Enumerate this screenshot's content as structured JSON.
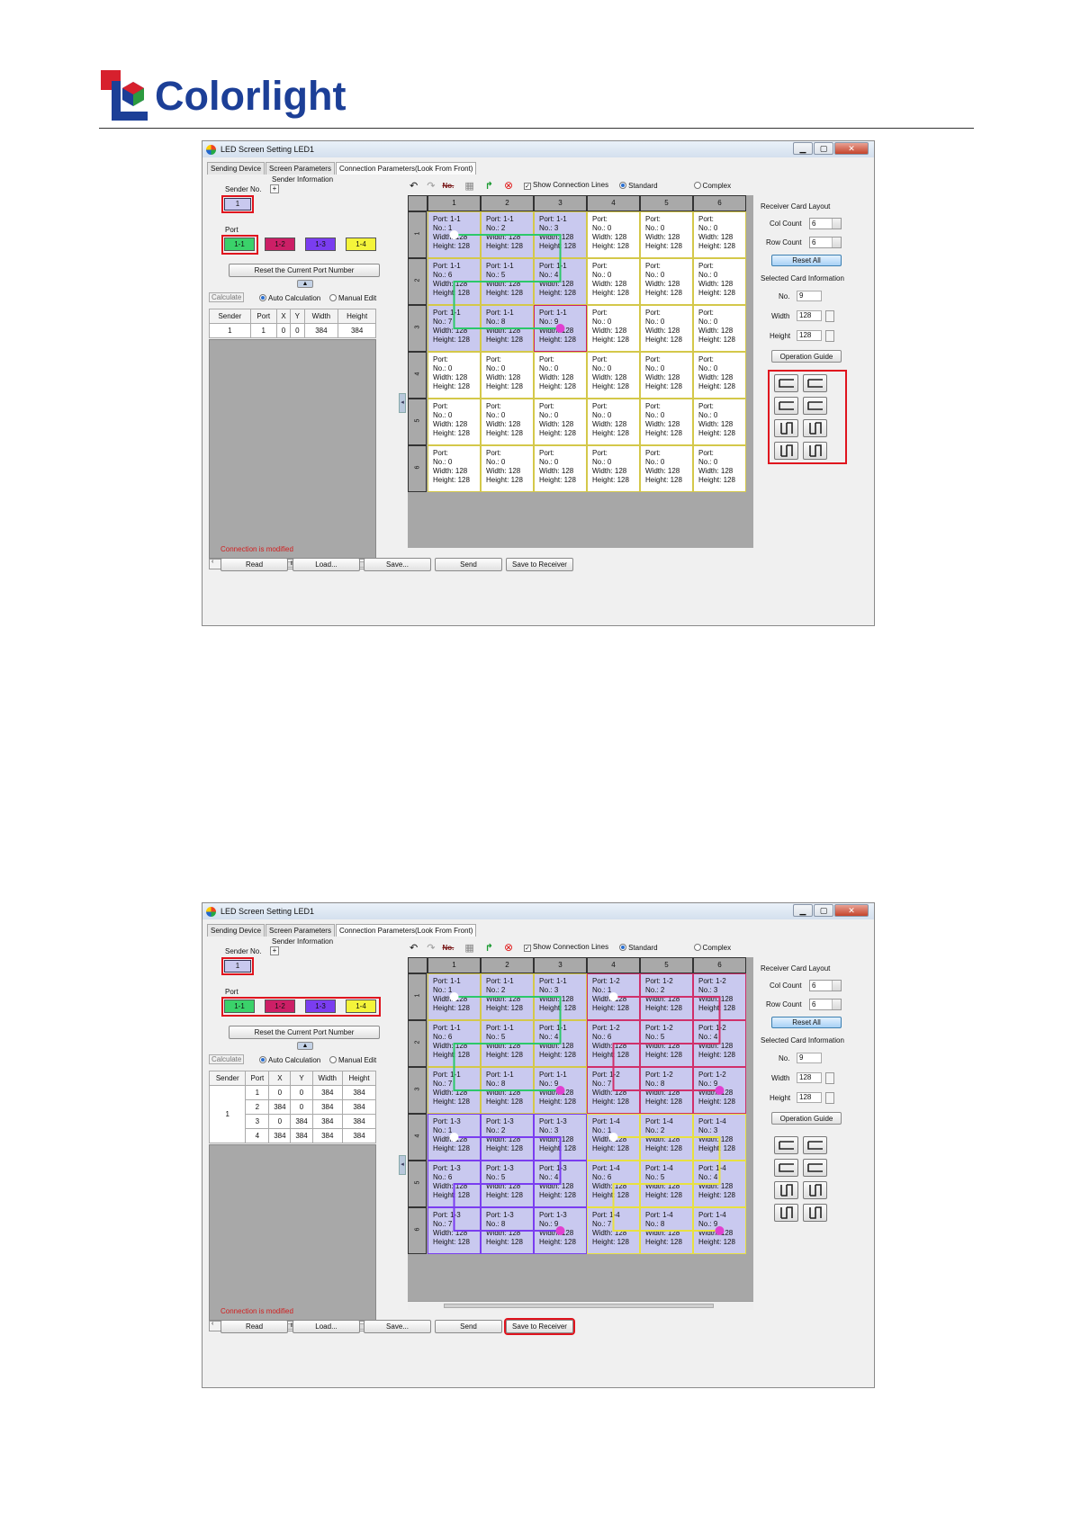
{
  "brand": {
    "name": "Colorlight"
  },
  "windows": [
    {
      "title": "LED Screen Setting LED1",
      "window_buttons": [
        "▁",
        "▢",
        "✕"
      ],
      "tabs": [
        "Sending Device",
        "Screen Parameters",
        "Connection Parameters(Look From Front)"
      ],
      "sender_info_label": "Sender Information",
      "sender_no_label": "Sender No.",
      "sender_no_plus": "+",
      "sender_btn": "1",
      "port_label": "Port",
      "ports": [
        "1-1",
        "1-2",
        "1-3",
        "1-4"
      ],
      "reset_port_btn": "Reset the Current Port Number",
      "calculate_label": "Calculate",
      "auto_calc": "Auto Calculation",
      "manual_edit": "Manual Edit",
      "table_headers": [
        "Sender",
        "Port",
        "X",
        "Y",
        "Width",
        "Height"
      ],
      "table_rows": [
        [
          "1",
          "1",
          "0",
          "0",
          "384",
          "384"
        ]
      ],
      "scroll_thumb_text": "III",
      "status_text": "Connection is modified",
      "bottom_buttons": [
        "Read",
        "Load...",
        "Save...",
        "Send",
        "Save to Receiver"
      ],
      "toolbar": {
        "undo": "↶",
        "redo": "↷",
        "no": "No.",
        "grid": "▦",
        "route": "↱",
        "clear": "⊗",
        "show_lines": "Show Connection Lines",
        "standard": "Standard",
        "complex": "Complex"
      },
      "columns": [
        "1",
        "2",
        "3",
        "4",
        "5",
        "6"
      ],
      "rows": [
        "1",
        "2",
        "3",
        "4",
        "5",
        "6"
      ],
      "cells": [
        [
          [
            "Port: 1-1",
            "No.: 1",
            "Width: 128",
            "Height: 128"
          ],
          [
            "Port: 1-1",
            "No.: 2",
            "Width: 128",
            "Height: 128"
          ],
          [
            "Port: 1-1",
            "No.: 3",
            "Width: 128",
            "Height: 128"
          ],
          [
            "Port:",
            "No.: 0",
            "Width: 128",
            "Height: 128"
          ],
          [
            "Port:",
            "No.: 0",
            "Width: 128",
            "Height: 128"
          ],
          [
            "Port:",
            "No.: 0",
            "Width: 128",
            "Height: 128"
          ]
        ],
        [
          [
            "Port: 1-1",
            "No.: 6",
            "Width: 128",
            "Height: 128"
          ],
          [
            "Port: 1-1",
            "No.: 5",
            "Width: 128",
            "Height: 128"
          ],
          [
            "Port: 1-1",
            "No.: 4",
            "Width: 128",
            "Height: 128"
          ],
          [
            "Port:",
            "No.: 0",
            "Width: 128",
            "Height: 128"
          ],
          [
            "Port:",
            "No.: 0",
            "Width: 128",
            "Height: 128"
          ],
          [
            "Port:",
            "No.: 0",
            "Width: 128",
            "Height: 128"
          ]
        ],
        [
          [
            "Port: 1-1",
            "No.: 7",
            "Width: 128",
            "Height: 128"
          ],
          [
            "Port: 1-1",
            "No.: 8",
            "Width: 128",
            "Height: 128"
          ],
          [
            "Port: 1-1",
            "No.: 9",
            "Width: 128",
            "Height: 128"
          ],
          [
            "Port:",
            "No.: 0",
            "Width: 128",
            "Height: 128"
          ],
          [
            "Port:",
            "No.: 0",
            "Width: 128",
            "Height: 128"
          ],
          [
            "Port:",
            "No.: 0",
            "Width: 128",
            "Height: 128"
          ]
        ],
        [
          [
            "Port:",
            "No.: 0",
            "Width: 128",
            "Height: 128"
          ],
          [
            "Port:",
            "No.: 0",
            "Width: 128",
            "Height: 128"
          ],
          [
            "Port:",
            "No.: 0",
            "Width: 128",
            "Height: 128"
          ],
          [
            "Port:",
            "No.: 0",
            "Width: 128",
            "Height: 128"
          ],
          [
            "Port:",
            "No.: 0",
            "Width: 128",
            "Height: 128"
          ],
          [
            "Port:",
            "No.: 0",
            "Width: 128",
            "Height: 128"
          ]
        ],
        [
          [
            "Port:",
            "No.: 0",
            "Width: 128",
            "Height: 128"
          ],
          [
            "Port:",
            "No.: 0",
            "Width: 128",
            "Height: 128"
          ],
          [
            "Port:",
            "No.: 0",
            "Width: 128",
            "Height: 128"
          ],
          [
            "Port:",
            "No.: 0",
            "Width: 128",
            "Height: 128"
          ],
          [
            "Port:",
            "No.: 0",
            "Width: 128",
            "Height: 128"
          ],
          [
            "Port:",
            "No.: 0",
            "Width: 128",
            "Height: 128"
          ]
        ],
        [
          [
            "Port:",
            "No.: 0",
            "Width: 128",
            "Height: 128"
          ],
          [
            "Port:",
            "No.: 0",
            "Width: 128",
            "Height: 128"
          ],
          [
            "Port:",
            "No.: 0",
            "Width: 128",
            "Height: 128"
          ],
          [
            "Port:",
            "No.: 0",
            "Width: 128",
            "Height: 128"
          ],
          [
            "Port:",
            "No.: 0",
            "Width: 128",
            "Height: 128"
          ],
          [
            "Port:",
            "No.: 0",
            "Width: 128",
            "Height: 128"
          ]
        ]
      ],
      "right": {
        "layout_label": "Receiver Card Layout",
        "col_label": "Col Count",
        "col_val": "6",
        "row_label": "Row Count",
        "row_val": "6",
        "reset_all": "Reset All",
        "selected_label": "Selected Card Information",
        "no_label": "No.",
        "no_val": "9",
        "width_label": "Width",
        "width_val": "128",
        "height_label": "Height",
        "height_val": "128",
        "guide_btn": "Operation Guide"
      }
    },
    {
      "title": "LED Screen Setting LED1",
      "window_buttons": [
        "▁",
        "▢",
        "✕"
      ],
      "tabs": [
        "Sending Device",
        "Screen Parameters",
        "Connection Parameters(Look From Front)"
      ],
      "sender_info_label": "Sender Information",
      "sender_no_label": "Sender No.",
      "sender_no_plus": "+",
      "sender_btn": "1",
      "port_label": "Port",
      "ports": [
        "1-1",
        "1-2",
        "1-3",
        "1-4"
      ],
      "reset_port_btn": "Reset the Current Port Number",
      "calculate_label": "Calculate",
      "auto_calc": "Auto Calculation",
      "manual_edit": "Manual Edit",
      "table_headers": [
        "Sender",
        "Port",
        "X",
        "Y",
        "Width",
        "Height"
      ],
      "table_rows": [
        [
          "1",
          "1",
          "0",
          "0",
          "384",
          "384"
        ],
        [
          "",
          "2",
          "384",
          "0",
          "384",
          "384"
        ],
        [
          "",
          "3",
          "0",
          "384",
          "384",
          "384"
        ],
        [
          "",
          "4",
          "384",
          "384",
          "384",
          "384"
        ]
      ],
      "scroll_thumb_text": "III",
      "status_text": "Connection is modified",
      "bottom_buttons": [
        "Read",
        "Load...",
        "Save...",
        "Send",
        "Save to Receiver"
      ],
      "toolbar": {
        "undo": "↶",
        "redo": "↷",
        "no": "No.",
        "grid": "▦",
        "route": "↱",
        "clear": "⊗",
        "show_lines": "Show Connection Lines",
        "standard": "Standard",
        "complex": "Complex"
      },
      "columns": [
        "1",
        "2",
        "3",
        "4",
        "5",
        "6"
      ],
      "rows": [
        "1",
        "2",
        "3",
        "4",
        "5",
        "6"
      ],
      "cells": [
        [
          [
            "Port: 1-1",
            "No.: 1",
            "Width: 128",
            "Height: 128"
          ],
          [
            "Port: 1-1",
            "No.: 2",
            "Width: 128",
            "Height: 128"
          ],
          [
            "Port: 1-1",
            "No.: 3",
            "Width: 128",
            "Height: 128"
          ],
          [
            "Port: 1-2",
            "No.: 1",
            "Width: 128",
            "Height: 128"
          ],
          [
            "Port: 1-2",
            "No.: 2",
            "Width: 128",
            "Height: 128"
          ],
          [
            "Port: 1-2",
            "No.: 3",
            "Width: 128",
            "Height: 128"
          ]
        ],
        [
          [
            "Port: 1-1",
            "No.: 6",
            "Width: 128",
            "Height: 128"
          ],
          [
            "Port: 1-1",
            "No.: 5",
            "Width: 128",
            "Height: 128"
          ],
          [
            "Port: 1-1",
            "No.: 4",
            "Width: 128",
            "Height: 128"
          ],
          [
            "Port: 1-2",
            "No.: 6",
            "Width: 128",
            "Height: 128"
          ],
          [
            "Port: 1-2",
            "No.: 5",
            "Width: 128",
            "Height: 128"
          ],
          [
            "Port: 1-2",
            "No.: 4",
            "Width: 128",
            "Height: 128"
          ]
        ],
        [
          [
            "Port: 1-1",
            "No.: 7",
            "Width: 128",
            "Height: 128"
          ],
          [
            "Port: 1-1",
            "No.: 8",
            "Width: 128",
            "Height: 128"
          ],
          [
            "Port: 1-1",
            "No.: 9",
            "Width: 128",
            "Height: 128"
          ],
          [
            "Port: 1-2",
            "No.: 7",
            "Width: 128",
            "Height: 128"
          ],
          [
            "Port: 1-2",
            "No.: 8",
            "Width: 128",
            "Height: 128"
          ],
          [
            "Port: 1-2",
            "No.: 9",
            "Width: 128",
            "Height: 128"
          ]
        ],
        [
          [
            "Port: 1-3",
            "No.: 1",
            "Width: 128",
            "Height: 128"
          ],
          [
            "Port: 1-3",
            "No.: 2",
            "Width: 128",
            "Height: 128"
          ],
          [
            "Port: 1-3",
            "No.: 3",
            "Width: 128",
            "Height: 128"
          ],
          [
            "Port: 1-4",
            "No.: 1",
            "Width: 128",
            "Height: 128"
          ],
          [
            "Port: 1-4",
            "No.: 2",
            "Width: 128",
            "Height: 128"
          ],
          [
            "Port: 1-4",
            "No.: 3",
            "Width: 128",
            "Height: 128"
          ]
        ],
        [
          [
            "Port: 1-3",
            "No.: 6",
            "Width: 128",
            "Height: 128"
          ],
          [
            "Port: 1-3",
            "No.: 5",
            "Width: 128",
            "Height: 128"
          ],
          [
            "Port: 1-3",
            "No.: 4",
            "Width: 128",
            "Height: 128"
          ],
          [
            "Port: 1-4",
            "No.: 6",
            "Width: 128",
            "Height: 128"
          ],
          [
            "Port: 1-4",
            "No.: 5",
            "Width: 128",
            "Height: 128"
          ],
          [
            "Port: 1-4",
            "No.: 4",
            "Width: 128",
            "Height: 128"
          ]
        ],
        [
          [
            "Port: 1-3",
            "No.: 7",
            "Width: 128",
            "Height: 128"
          ],
          [
            "Port: 1-3",
            "No.: 8",
            "Width: 128",
            "Height: 128"
          ],
          [
            "Port: 1-3",
            "No.: 9",
            "Width: 128",
            "Height: 128"
          ],
          [
            "Port: 1-4",
            "No.: 7",
            "Width: 128",
            "Height: 128"
          ],
          [
            "Port: 1-4",
            "No.: 8",
            "Width: 128",
            "Height: 128"
          ],
          [
            "Port: 1-4",
            "No.: 9",
            "Width: 128",
            "Height: 128"
          ]
        ]
      ],
      "right": {
        "layout_label": "Receiver Card Layout",
        "col_label": "Col Count",
        "col_val": "6",
        "row_label": "Row Count",
        "row_val": "6",
        "reset_all": "Reset All",
        "selected_label": "Selected Card Information",
        "no_label": "No.",
        "no_val": "9",
        "width_label": "Width",
        "width_val": "128",
        "height_label": "Height",
        "height_val": "128",
        "guide_btn": "Operation Guide"
      }
    }
  ],
  "colors": {
    "brand_blue": "#1c3f97",
    "brand_red": "#d7202d",
    "port_1_1": "#3ad26a",
    "port_1_2": "#cc1f66",
    "port_1_3": "#7a3df0",
    "port_1_4": "#f4f43a",
    "cell_bg": "#c9c9ef",
    "cell_empty": "#ffffff",
    "highlight_red": "#e0141e",
    "line_1_1": "#2cc86a",
    "line_1_2": "#d0306a",
    "line_1_3": "#7a3df0",
    "line_1_4": "#e8e040"
  }
}
